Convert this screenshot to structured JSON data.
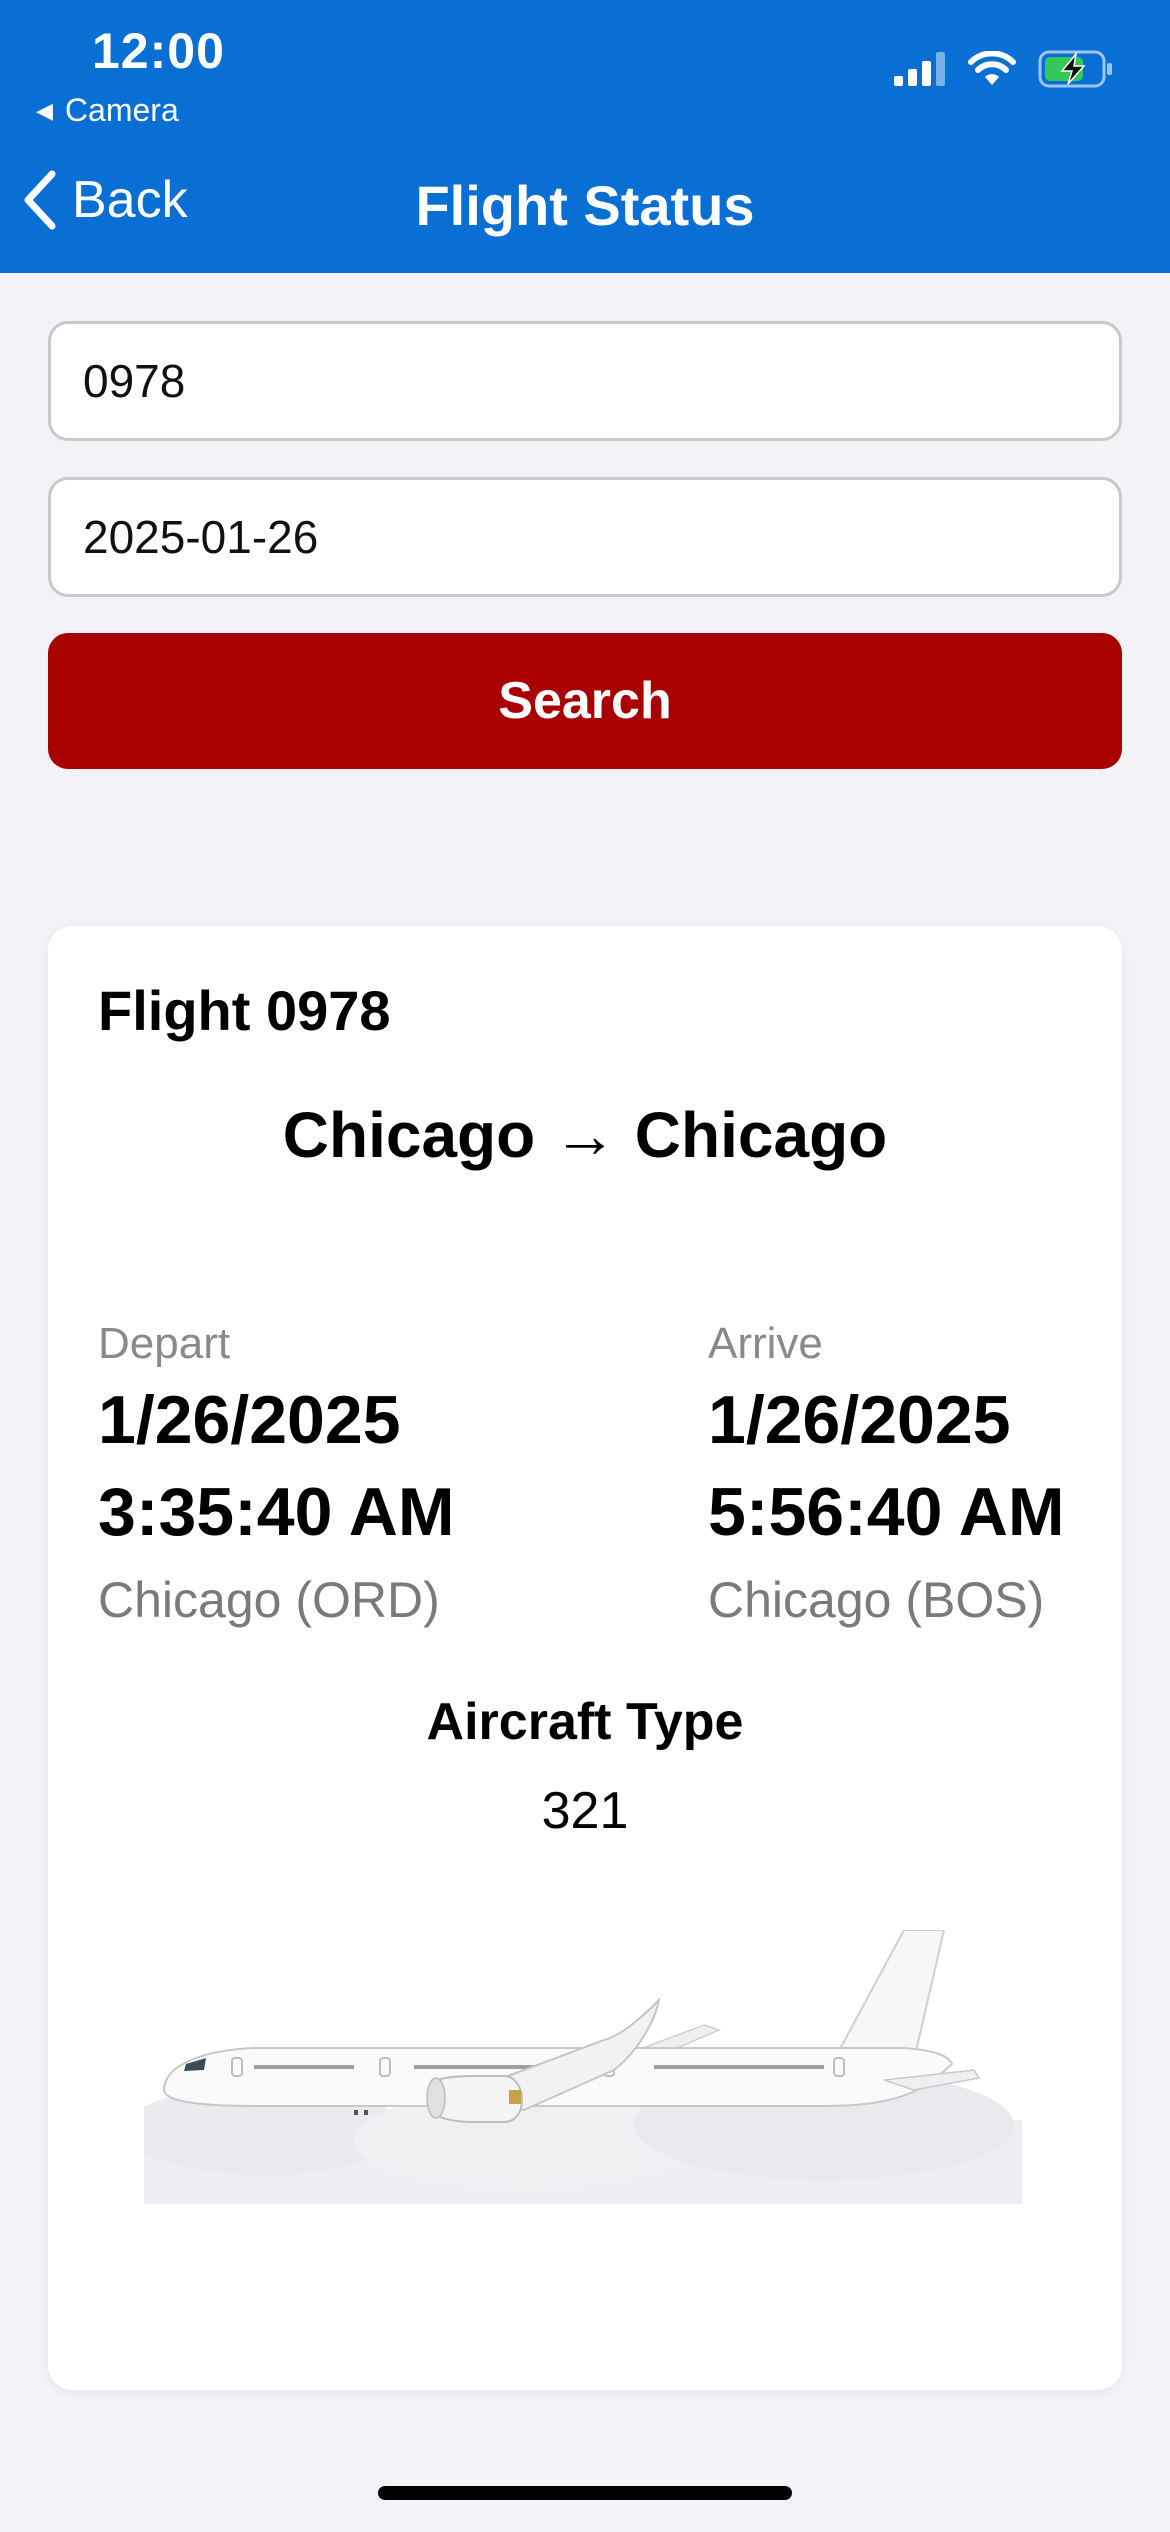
{
  "status_bar": {
    "time": "12:00",
    "back_app": "Camera",
    "icons": [
      "signal-icon",
      "wifi-icon",
      "battery-charging-icon"
    ]
  },
  "nav": {
    "back_label": "Back",
    "title": "Flight Status"
  },
  "form": {
    "flight_number": "0978",
    "date": "2025-01-26",
    "search_label": "Search"
  },
  "result": {
    "title": "Flight 0978",
    "route": "Chicago → Chicago",
    "depart": {
      "label": "Depart",
      "date": "1/26/2025",
      "time": "3:35:40 AM",
      "city": "Chicago (ORD)"
    },
    "arrive": {
      "label": "Arrive",
      "date": "1/26/2025",
      "time": "5:56:40 AM",
      "city": "Chicago (BOS)"
    },
    "aircraft_label": "Aircraft Type",
    "aircraft_value": "321"
  },
  "colors": {
    "header": "#0a6fd4",
    "search_button": "#a90000"
  }
}
